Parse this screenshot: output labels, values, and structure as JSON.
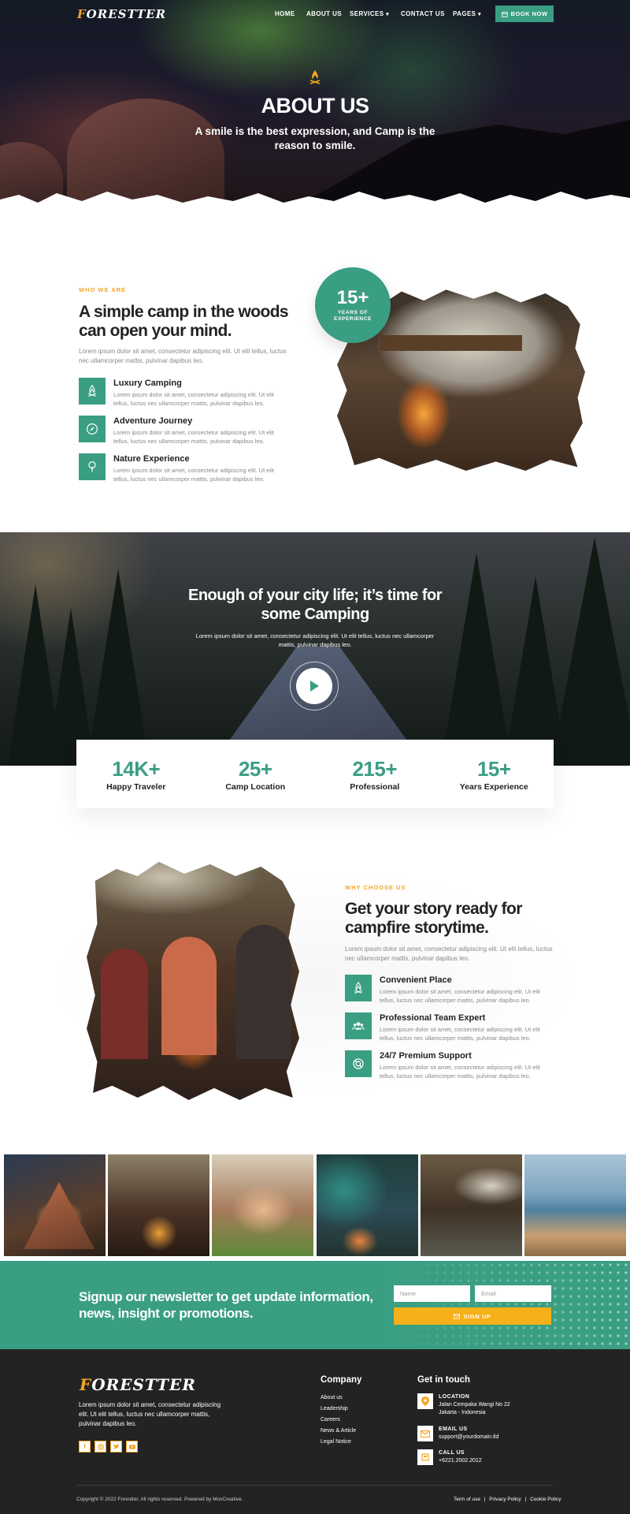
{
  "brand": {
    "logo_prefix": "F",
    "logo_rest": "ORESTTER"
  },
  "nav": {
    "items": [
      "HOME",
      "ABOUT US",
      "SERVICES",
      "CONTACT US",
      "PAGES"
    ],
    "book_now": "BOOK NOW"
  },
  "hero": {
    "title": "ABOUT US",
    "subtitle_line1": "A smile is the best expression, and Camp is the",
    "subtitle_line2": "reason to smile."
  },
  "about": {
    "eyebrow": "WHO WE ARE",
    "title_line1": "A simple camp in the woods",
    "title_line2": "can open your mind.",
    "lead_line1": "Lorem ipsum dolor sit amet, consectetur adipiscing elit. Ut elit tellus, luctus",
    "lead_line2": "nec ullamcorper mattis, pulvinar dapibus leo.",
    "features": [
      {
        "title": "Luxury Camping",
        "desc1": "Lorem ipsum dolor sit amet, consectetur adipiscing elit. Ut elit",
        "desc2": "tellus, luctus nec ullamcorper mattis, pulvinar dapibus leo.",
        "icon": "campfire-icon"
      },
      {
        "title": "Adventure Journey",
        "desc1": "Lorem ipsum dolor sit amet, consectetur adipiscing elit. Ut elit",
        "desc2": "tellus, luctus nec ullamcorper mattis, pulvinar dapibus leo.",
        "icon": "compass-icon"
      },
      {
        "title": "Nature Experience",
        "desc1": "Lorem ipsum dolor sit amet, consectetur adipiscing elit. Ut elit",
        "desc2": "tellus, luctus nec ullamcorper mattis, pulvinar dapibus leo.",
        "icon": "tree-icon"
      }
    ],
    "badge_value": "15+",
    "badge_line1": "YEARS OF",
    "badge_line2": "EXPERIENCE"
  },
  "video": {
    "title_line1": "Enough of your city life; it’s time for",
    "title_line2": "some Camping",
    "text_line1": "Lorem ipsum dolor sit amet, consectetur adipiscing elit. Ut elit tellus, luctus nec ullamcorper",
    "text_line2": "mattis, pulvinar dapibus leo."
  },
  "stats": [
    {
      "value": "14K+",
      "label": "Happy Traveler"
    },
    {
      "value": "25+",
      "label": "Camp Location"
    },
    {
      "value": "215+",
      "label": "Professional"
    },
    {
      "value": "15+",
      "label": "Years Experience"
    }
  ],
  "why": {
    "eyebrow": "WHY CHOOSE US",
    "title_line1": "Get your story ready for",
    "title_line2": "campfire storytime.",
    "lead_line1": "Lorem ipsum dolor sit amet, consectetur adipiscing elit. Ut elit tellus, luctus",
    "lead_line2": "nec ullamcorper mattis, pulvinar dapibus leo.",
    "features": [
      {
        "title": "Convenient Place",
        "desc1": "Lorem ipsum dolor sit amet, consectetur adipiscing elit. Ut elit",
        "desc2": "tellus, luctus nec ullamcorper mattis, pulvinar dapibus leo.",
        "icon": "campfire-icon"
      },
      {
        "title": "Professional Team Expert",
        "desc1": "Lorem ipsum dolor sit amet, consectetur adipiscing elit. Ut elit",
        "desc2": "tellus, luctus nec ullamcorper mattis, pulvinar dapibus leo.",
        "icon": "team-icon"
      },
      {
        "title": "24/7 Premium Support",
        "desc1": "Lorem ipsum dolor sit amet, consectetur adipiscing elit. Ut elit",
        "desc2": "tellus, luctus nec ullamcorper mattis, pulvinar dapibus leo.",
        "icon": "support-icon"
      }
    ]
  },
  "newsletter": {
    "title_line1": "Signup our newsletter to get update information,",
    "title_line2": "news, insight or promotions.",
    "name_placeholder": "Name",
    "email_placeholder": "Email",
    "button": "SIGN UP"
  },
  "footer": {
    "about_line1": "Lorem ipsum dolor sit amet, consectetur adipiscing",
    "about_line2": "elit. Ut elit tellus, luctus nec ullamcorper mattis,",
    "about_line3": "pulvinar dapibus leo.",
    "company_title": "Company",
    "company_links": [
      "About us",
      "Leadership",
      "Careers",
      "News & Article",
      "Legal Notice"
    ],
    "contact_title": "Get in touch",
    "location_label": "LOCATION",
    "location_line1": "Jalan Cempaka Wangi No 22",
    "location_line2": "Jakarta - Indonesia",
    "email_label": "EMAIL US",
    "email_value": "support@yourdomain.tld",
    "call_label": "CALL US",
    "call_value": "+6221.2002.2012",
    "copyright": "Copyright © 2022 Forestter, All rights reserved. Powered by MoxCreative.",
    "legal_links": [
      "Term of use",
      "Privacy Policy",
      "Cookie Policy"
    ]
  },
  "colors": {
    "accent": "#3a9e83",
    "brand_orange": "#f5a623",
    "footer_bg": "#232323"
  }
}
